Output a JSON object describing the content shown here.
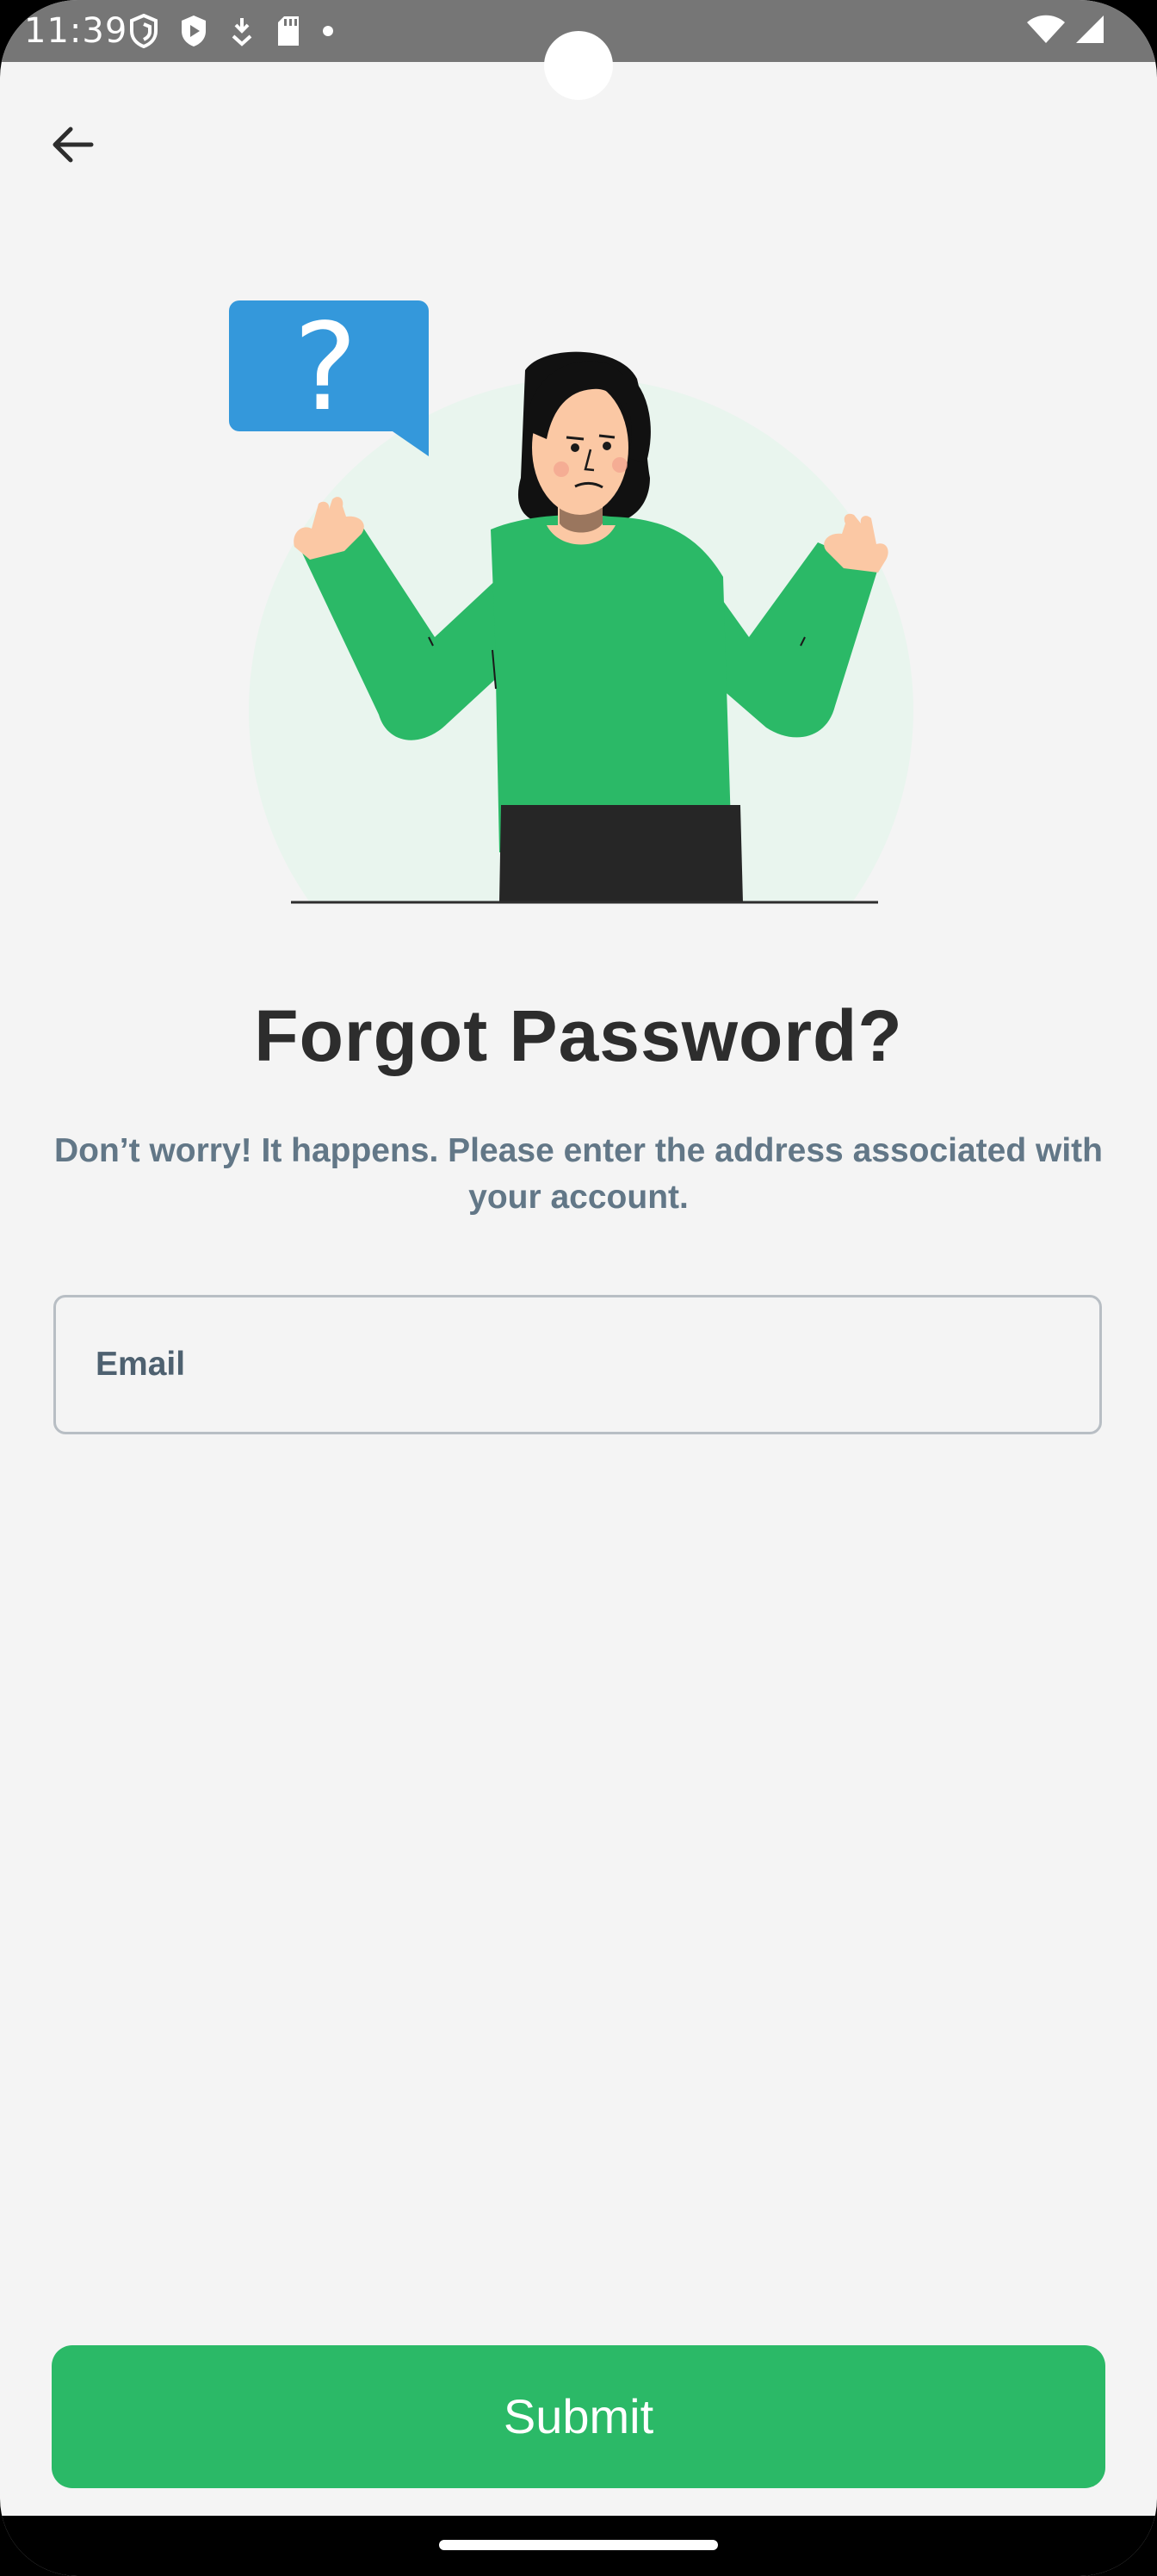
{
  "status_bar": {
    "time": "11:39",
    "left_icons": [
      "shield-outline-icon",
      "shield-play-icon",
      "download-icon",
      "sd-card-icon",
      "dot-icon"
    ],
    "right_icons": [
      "wifi-icon",
      "signal-icon"
    ]
  },
  "header": {
    "back_icon": "arrow-left-icon"
  },
  "illustration": {
    "bubble_text": "?",
    "accent": "#3498db",
    "shirt": "#2bb967"
  },
  "content": {
    "title": "Forgot Password?",
    "subtitle": "Don’t worry! It happens. Please enter the address associated with your account."
  },
  "form": {
    "email_placeholder": "Email",
    "email_value": ""
  },
  "actions": {
    "submit_label": "Submit"
  },
  "colors": {
    "primary": "#2bb967",
    "background": "#f4f4f4",
    "title": "#2d2d2d",
    "subtitle": "#627787"
  }
}
